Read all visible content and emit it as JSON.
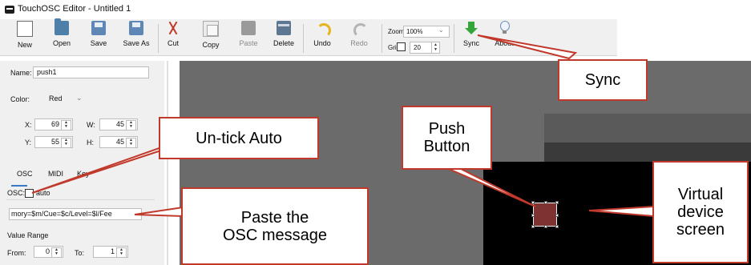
{
  "window": {
    "title": "TouchOSC Editor - Untitled 1"
  },
  "toolbar": {
    "new": "New",
    "open": "Open",
    "save": "Save",
    "save_as": "Save As",
    "cut": "Cut",
    "copy": "Copy",
    "paste": "Paste",
    "delete": "Delete",
    "undo": "Undo",
    "redo": "Redo",
    "zoom_label": "Zoom",
    "zoom_value": "100%",
    "grid_label": "Grid",
    "grid_value": "20",
    "sync": "Sync",
    "about": "About"
  },
  "panel": {
    "name_label": "Name:",
    "name_value": "push1",
    "color_label": "Color:",
    "color_value": "Red",
    "x_label": "X:",
    "x_value": "69",
    "w_label": "W:",
    "w_value": "45",
    "y_label": "Y:",
    "y_value": "55",
    "h_label": "H:",
    "h_value": "45",
    "tabs": [
      "OSC",
      "MIDI",
      "Key"
    ],
    "osc_label": "OSC:",
    "auto_label": "auto",
    "auto_checked": false,
    "osc_message": "mory=$m/Cue=$c/Level=$l/Fee",
    "value_range_label": "Value Range",
    "from_label": "From:",
    "from_value": "0",
    "to_label": "To:",
    "to_value": "1"
  },
  "callouts": {
    "sync": "Sync",
    "untick": "Un-tick Auto",
    "push": "Push\nButton",
    "paste": "Paste the\nOSC message",
    "virtual": "Virtual\ndevice\nscreen"
  },
  "colors": {
    "callout_border": "#c0392b",
    "push_button": "#7e3232",
    "canvas": "#6b6b6b"
  }
}
